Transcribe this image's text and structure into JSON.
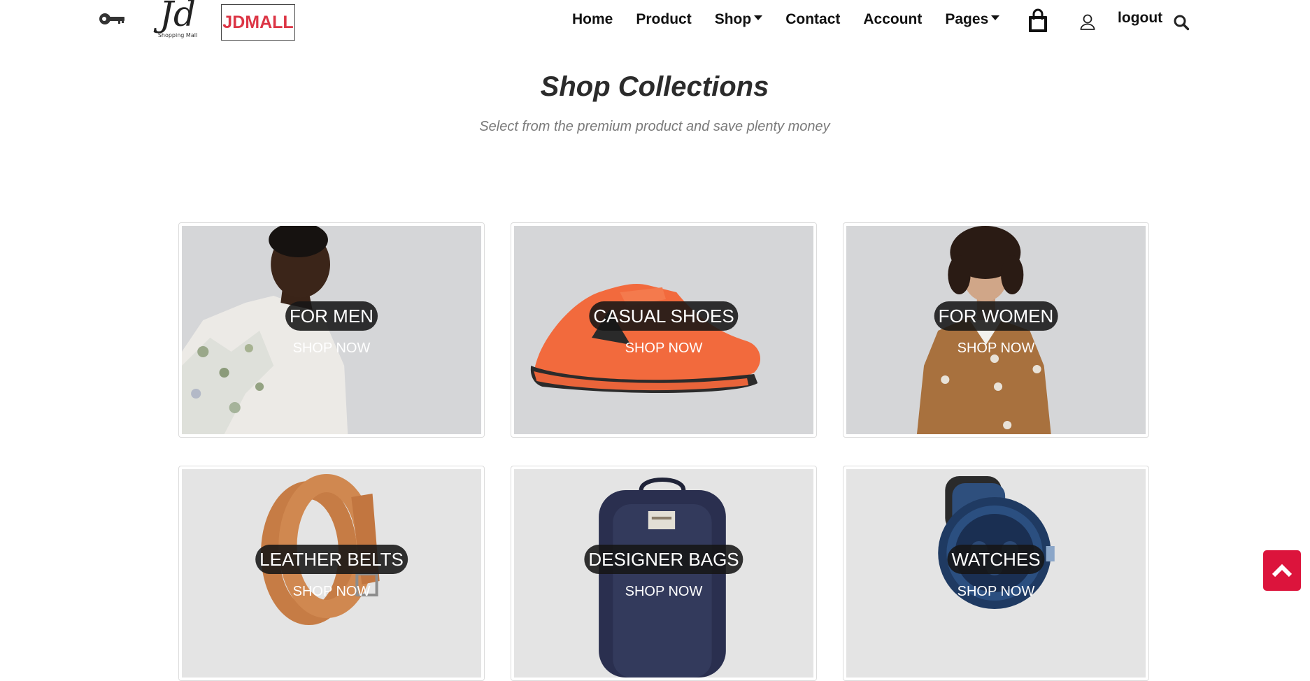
{
  "brand": {
    "logo_letters": "Jd",
    "logo_tagline": "Shopping Mall",
    "badge_text": "JDMALL",
    "badge_color": "#dc3545"
  },
  "nav": {
    "items": [
      {
        "label": "Home",
        "dropdown": false
      },
      {
        "label": "Product",
        "dropdown": false
      },
      {
        "label": "Shop",
        "dropdown": true
      },
      {
        "label": "Contact",
        "dropdown": false
      },
      {
        "label": "Account",
        "dropdown": false
      },
      {
        "label": "Pages",
        "dropdown": true
      }
    ],
    "logout_label": "logout",
    "icons": [
      "key-icon",
      "shopping-bag-icon",
      "user-icon",
      "search-icon"
    ]
  },
  "header": {
    "title": "Shop Collections",
    "subtitle": "Select from the premium product and save plenty money"
  },
  "collections": [
    {
      "label": "FOR MEN",
      "cta": "SHOP NOW"
    },
    {
      "label": "CASUAL SHOES",
      "cta": "SHOP NOW"
    },
    {
      "label": "FOR WOMEN",
      "cta": "SHOP NOW"
    },
    {
      "label": "LEATHER BELTS",
      "cta": "SHOP NOW"
    },
    {
      "label": "DESIGNER BAGS",
      "cta": "SHOP NOW"
    },
    {
      "label": "WATCHES",
      "cta": "SHOP NOW"
    }
  ],
  "back_to_top": {
    "icon": "chevron-up-icon",
    "color": "#dc143c"
  }
}
